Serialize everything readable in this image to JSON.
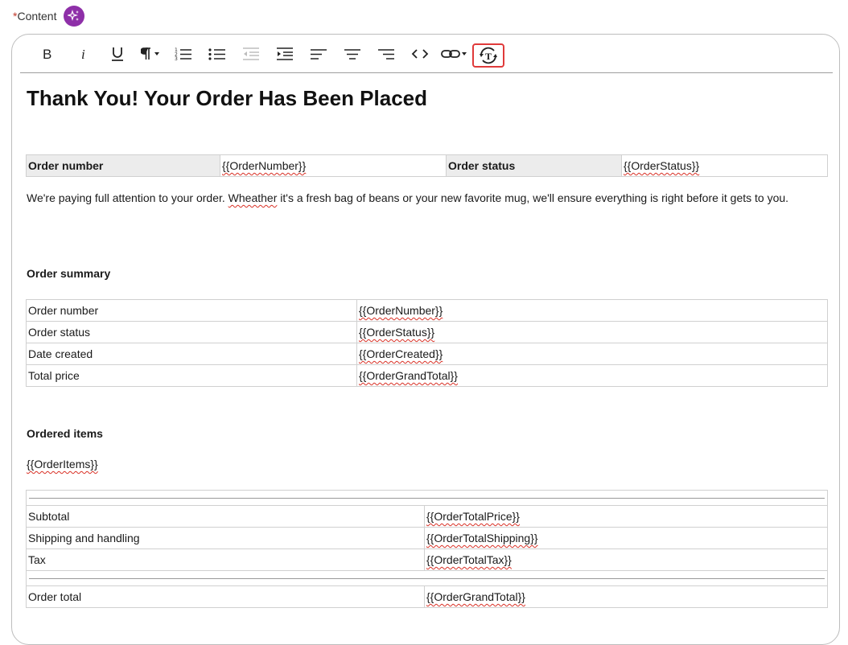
{
  "field": {
    "required_mark": "*",
    "label": "Content",
    "ai_icon": "sparkles-icon"
  },
  "toolbar": {
    "buttons": [
      {
        "name": "bold-button",
        "icon": "bold-icon"
      },
      {
        "name": "italic-button",
        "icon": "italic-icon"
      },
      {
        "name": "underline-button",
        "icon": "underline-icon"
      },
      {
        "name": "paragraph-format-button",
        "icon": "pilcrow-icon"
      },
      {
        "name": "ordered-list-button",
        "icon": "ordered-list-icon"
      },
      {
        "name": "bullet-list-button",
        "icon": "bullet-list-icon"
      },
      {
        "name": "outdent-button",
        "icon": "outdent-icon",
        "disabled": true
      },
      {
        "name": "indent-button",
        "icon": "indent-icon"
      },
      {
        "name": "align-left-button",
        "icon": "align-left-icon"
      },
      {
        "name": "align-center-button",
        "icon": "align-center-icon"
      },
      {
        "name": "align-right-button",
        "icon": "align-right-icon"
      },
      {
        "name": "source-code-button",
        "icon": "code-icon"
      },
      {
        "name": "insert-link-button",
        "icon": "link-icon"
      },
      {
        "name": "placeholder-button",
        "icon": "text-placeholder-icon",
        "highlighted": true
      }
    ]
  },
  "document": {
    "title": "Thank You! Your Order Has Been Placed",
    "header_table": {
      "order_number_label": "Order number",
      "order_number_value": "{{OrderNumber}}",
      "order_status_label": "Order status",
      "order_status_value": "{{OrderStatus}}"
    },
    "intro": {
      "part1": "We're paying full attention to your order. ",
      "misspelled": "Wheather",
      "part2": " it's a fresh bag of beans or your new favorite mug, we'll ensure everything is right before it gets to you."
    },
    "summary_heading": "Order summary",
    "summary_rows": [
      {
        "label": "Order number",
        "value": "{{OrderNumber}}"
      },
      {
        "label": "Order status",
        "value": "{{OrderStatus}}"
      },
      {
        "label": "Date created",
        "value": "{{OrderCreated}}"
      },
      {
        "label": "Total price",
        "value": "{{OrderGrandTotal}}"
      }
    ],
    "items_heading": "Ordered items",
    "items_placeholder": "{{OrderItems}}",
    "totals_rows": [
      {
        "label": "Subtotal",
        "value": "{{OrderTotalPrice}}"
      },
      {
        "label": "Shipping and handling",
        "value": "{{OrderTotalShipping}}"
      },
      {
        "label": "Tax",
        "value": "{{OrderTotalTax}}"
      }
    ],
    "grand_total": {
      "label": "Order total",
      "value": "{{OrderGrandTotal}}"
    }
  }
}
